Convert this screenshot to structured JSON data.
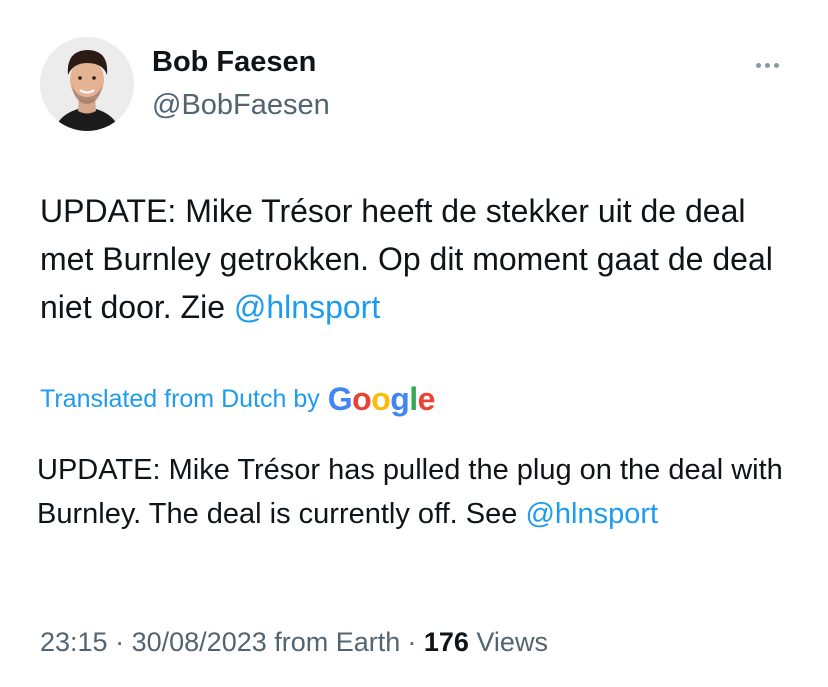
{
  "author": {
    "name": "Bob Faesen",
    "handle": "@BobFaesen",
    "avatar_icon": "profile-photo"
  },
  "more_icon": "more-horizontal-icon",
  "tweet": {
    "text_part1": "UPDATE: Mike Trésor heeft de stekker uit de deal met Burnley getrokken. Op dit moment gaat de deal niet door. Zie ",
    "mention": "@hlnsport"
  },
  "translation": {
    "label": "Translated from Dutch by",
    "provider_letters": [
      "G",
      "o",
      "o",
      "g",
      "l",
      "e"
    ],
    "provider_colors": [
      "#4285F4",
      "#EA4335",
      "#FBBC05",
      "#4285F4",
      "#34A853",
      "#EA4335"
    ],
    "text_part1": "UPDATE: Mike Trésor has pulled the plug on the deal with Burnley. The deal is currently off. See ",
    "mention": "@hlnsport"
  },
  "meta": {
    "time": "23:15",
    "separator": "·",
    "date": "30/08/2023",
    "source": "from Earth",
    "views_count": "176",
    "views_label": "Views"
  },
  "colors": {
    "link": "#1d9bf0",
    "secondary_text": "#536471",
    "primary_text": "#0f1419"
  }
}
